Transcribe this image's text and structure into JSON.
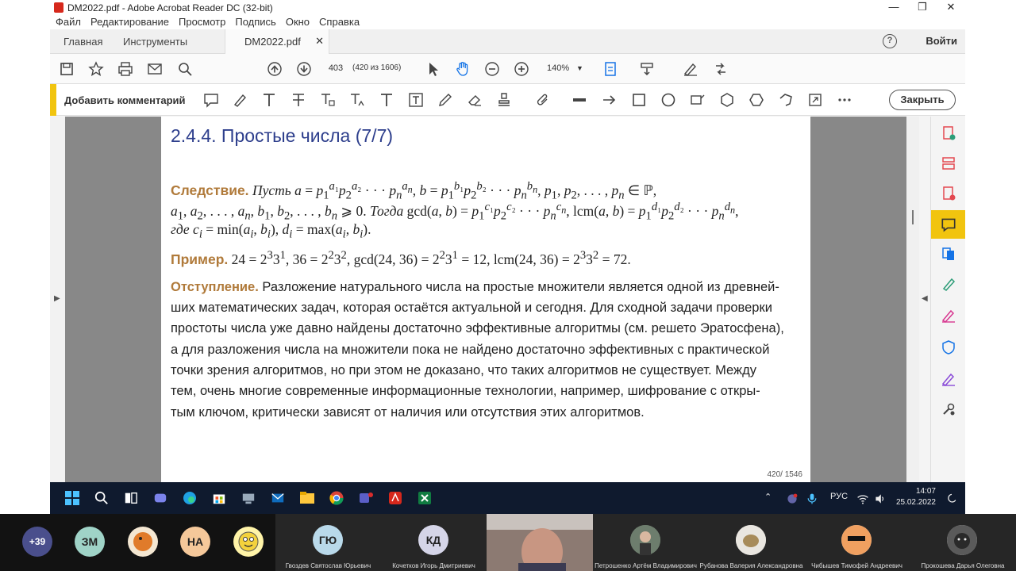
{
  "window": {
    "title": "DM2022.pdf - Adobe Acrobat Reader DC (32-bit)",
    "controls": [
      "—",
      "❐",
      "✕"
    ]
  },
  "menu": [
    "Файл",
    "Редактирование",
    "Просмотр",
    "Подпись",
    "Окно",
    "Справка"
  ],
  "tabs": {
    "home": "Главная",
    "tools": "Инструменты",
    "doc": "DM2022.pdf",
    "close": "✕",
    "help": "?",
    "login": "Войти"
  },
  "toolbar": {
    "page": "403",
    "page_of": "(420 из 1606)",
    "zoom": "140%"
  },
  "comment_bar": {
    "label": "Добавить комментарий",
    "close": "Закрыть"
  },
  "document": {
    "title": "2.4.4. Простые числа (7/7)",
    "corollary_label": "Следствие.",
    "example_label": "Пример.",
    "digression_label": "Отступление.",
    "digression_lines": [
      "Разложение натурального числа на простые множители является одной из древней-",
      "ших математических задач, которая остаётся актуальной и сегодня. Для сходной задачи проверки",
      "простоты числа уже давно найдены достаточно эффективные алгоритмы (см. решето Эратосфена),",
      "а для разложения числа на множители пока не найдено достаточно эффективных с практической",
      "точки зрения алгоритмов, но при этом не доказано, что таких алгоритмов не существует. Между",
      "тем, очень многие современные информационные технологии, например, шифрование с откры-",
      "тым ключом, критически зависят от наличия или отсутствия этих алгоритмов."
    ],
    "page_number": "420/ 1546"
  },
  "taskbar": {
    "lang": "РУС",
    "time": "14:07",
    "date": "25.02.2022"
  },
  "participants": {
    "more": "+39",
    "initials": [
      "ЗМ",
      "НА",
      "ГЮ",
      "КД"
    ],
    "names": [
      "Гвоздев Святослав Юрьевич",
      "Кочетков Игорь Дмитриевич",
      "Петрошенко Артём Владимирович",
      "Рубанова Валерия Александровна",
      "Чибышев Тимофей Андреевич",
      "Прокошева Дарья Олеговна"
    ]
  },
  "colors": {
    "title_blue": "#2d3e8c",
    "keyword_brown": "#b07a3a",
    "accent_yellow": "#f1c40f",
    "pdf_red": "#d6281c"
  }
}
